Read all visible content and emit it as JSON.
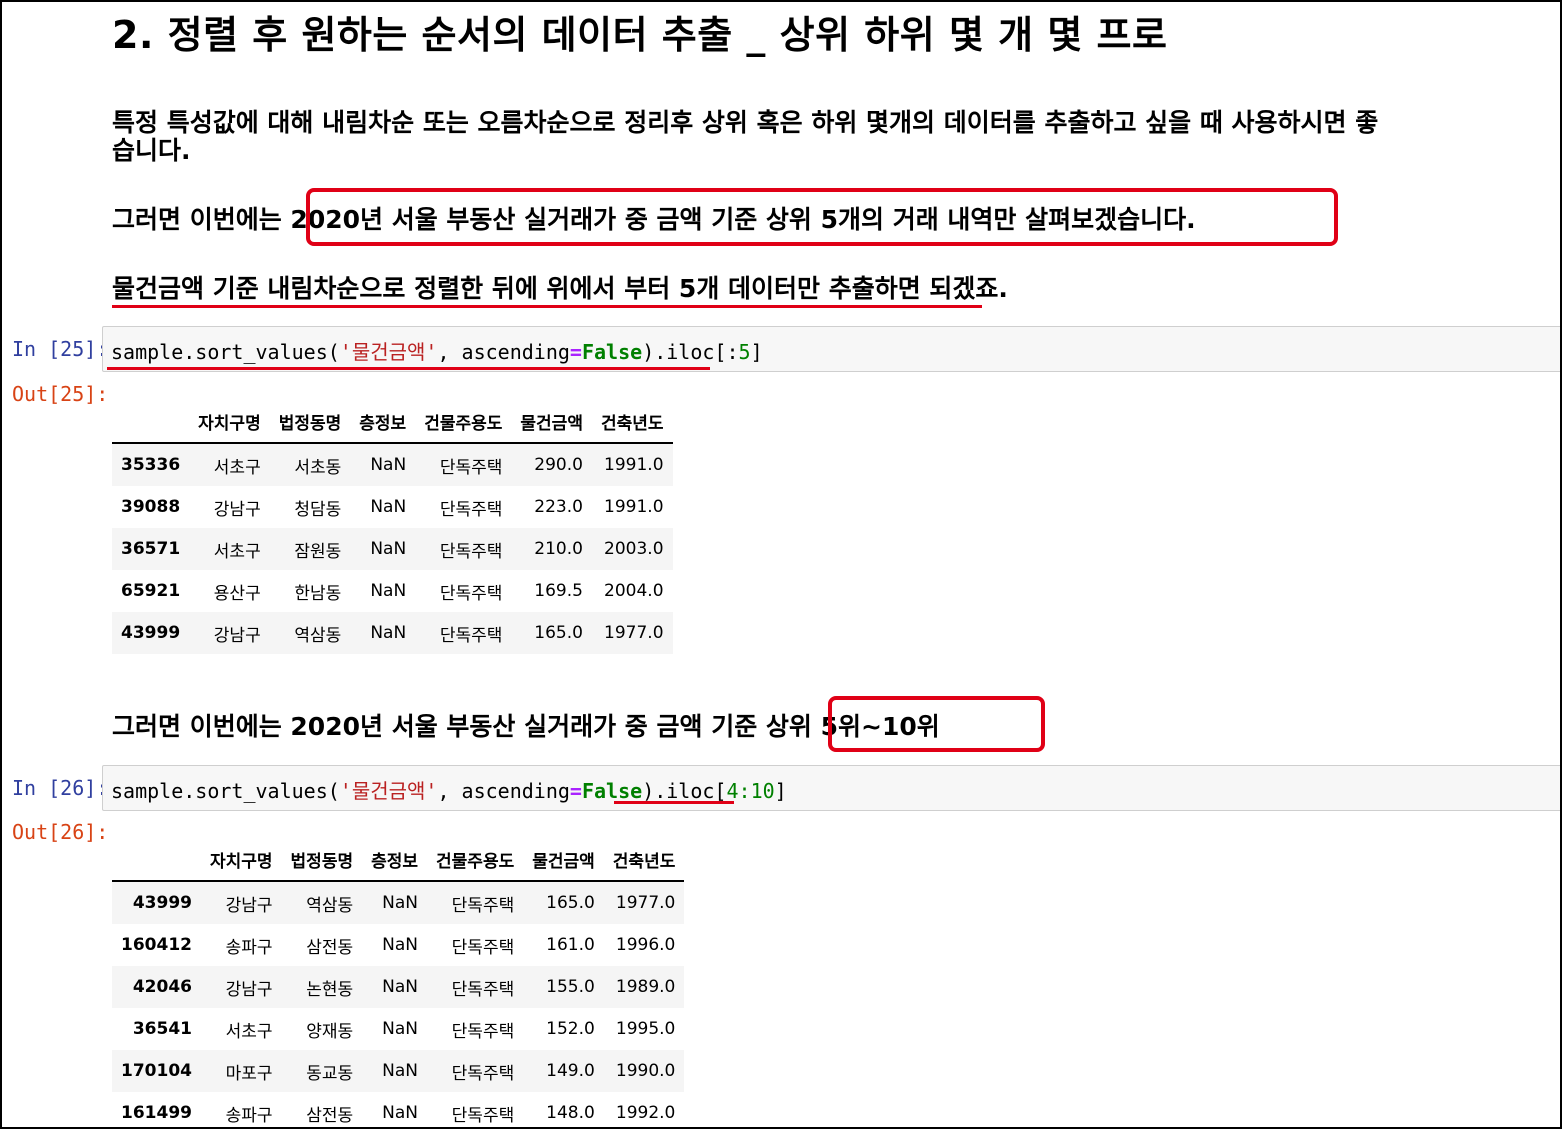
{
  "heading": "2. 정렬 후 원하는 순서의 데이터 추출 _ 상위 하위 몇 개 몇 프로",
  "intro_line1": "특정 특성값에 대해 내림차순 또는 오름차순으로 정리후 상위 혹은 하위 몇개의 데이터를 추출하고 싶을 때 사용하시면 좋",
  "intro_line2": "습니다.",
  "para1_prefix": "그러면 이번에는 ",
  "para1_boxed": "2020년 서울 부동산 실거래가 중 금액 기준 상위 5개의 거래 내역만 살펴보겠습니다.",
  "para2": "물건금액 기준 내림차순으로 정렬한 뒤에 위에서 부터 5개 데이터만 추출하면 되겠죠.",
  "cell25": {
    "in_prompt": "In [25]:",
    "out_prompt": "Out[25]:",
    "code": {
      "call": "sample.sort_values(",
      "str": "'물건금액'",
      "mid": ", ascending",
      "eq": "=",
      "kw": "False",
      "after": ").iloc[:",
      "num": "5",
      "close": "]"
    },
    "columns": [
      "자치구명",
      "법정동명",
      "층정보",
      "건물주용도",
      "물건금액",
      "건축년도"
    ],
    "rows": [
      {
        "index": "35336",
        "values": [
          "서초구",
          "서초동",
          "NaN",
          "단독주택",
          "290.0",
          "1991.0"
        ]
      },
      {
        "index": "39088",
        "values": [
          "강남구",
          "청담동",
          "NaN",
          "단독주택",
          "223.0",
          "1991.0"
        ]
      },
      {
        "index": "36571",
        "values": [
          "서초구",
          "잠원동",
          "NaN",
          "단독주택",
          "210.0",
          "2003.0"
        ]
      },
      {
        "index": "65921",
        "values": [
          "용산구",
          "한남동",
          "NaN",
          "단독주택",
          "169.5",
          "2004.0"
        ]
      },
      {
        "index": "43999",
        "values": [
          "강남구",
          "역삼동",
          "NaN",
          "단독주택",
          "165.0",
          "1977.0"
        ]
      }
    ]
  },
  "para3_prefix": "그러면 이번에는 2020년 서울 부동산 실거래가 중 금액 기준 ",
  "para3_boxed": "상위 5위~10위",
  "cell26": {
    "in_prompt": "In [26]:",
    "out_prompt": "Out[26]:",
    "code": {
      "call": "sample.sort_values(",
      "str": "'물건금액'",
      "mid": ", ascending",
      "eq": "=",
      "kw": "False",
      "after": ").iloc[",
      "num": "4:10",
      "close": "]"
    },
    "columns": [
      "자치구명",
      "법정동명",
      "층정보",
      "건물주용도",
      "물건금액",
      "건축년도"
    ],
    "rows": [
      {
        "index": "43999",
        "values": [
          "강남구",
          "역삼동",
          "NaN",
          "단독주택",
          "165.0",
          "1977.0"
        ]
      },
      {
        "index": "160412",
        "values": [
          "송파구",
          "삼전동",
          "NaN",
          "단독주택",
          "161.0",
          "1996.0"
        ]
      },
      {
        "index": "42046",
        "values": [
          "강남구",
          "논현동",
          "NaN",
          "단독주택",
          "155.0",
          "1989.0"
        ]
      },
      {
        "index": "36541",
        "values": [
          "서초구",
          "양재동",
          "NaN",
          "단독주택",
          "152.0",
          "1995.0"
        ]
      },
      {
        "index": "170104",
        "values": [
          "마포구",
          "동교동",
          "NaN",
          "단독주택",
          "149.0",
          "1990.0"
        ]
      },
      {
        "index": "161499",
        "values": [
          "송파구",
          "삼전동",
          "NaN",
          "단독주택",
          "148.0",
          "1992.0"
        ]
      }
    ]
  }
}
